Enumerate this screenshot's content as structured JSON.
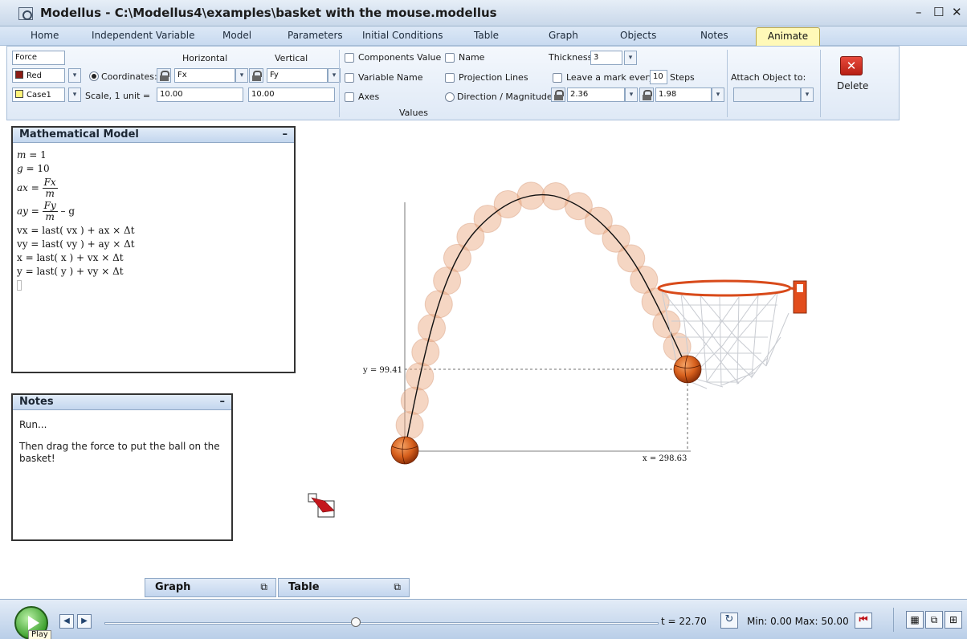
{
  "window": {
    "title": "Modellus - C:\\Modellus4\\examples\\basket with the mouse.modellus",
    "min": "–",
    "max": "☐",
    "close": "✕"
  },
  "tabs": [
    "Home",
    "Independent Variable",
    "Model",
    "Parameters",
    "Initial Conditions",
    "Table",
    "Graph",
    "Objects",
    "Notes",
    "Animate"
  ],
  "ribbon": {
    "name_value": "Force",
    "color_value": "Red",
    "color_swatch": "#8b1b13",
    "case_value": "Case1",
    "case_swatch": "#fff27a",
    "coordinates_label": "Coordinates:",
    "scale_label": "Scale, 1 unit =",
    "horizontal_label": "Horizontal",
    "vertical_label": "Vertical",
    "horizontal_var": "Fx",
    "vertical_var": "Fy",
    "horizontal_scale": "10.00",
    "vertical_scale": "10.00",
    "components_value": "Components Value",
    "variable_name": "Variable Name",
    "axes": "Axes",
    "name": "Name",
    "projection_lines": "Projection Lines",
    "direction_magnitude": "Direction / Magnitude:",
    "thickness_label": "Thickness:",
    "thickness_value": "3",
    "leave_mark": "Leave a mark every",
    "steps_value": "10",
    "steps_label": "Steps",
    "direction_value": "2.36",
    "magnitude_value": "1.98",
    "attach_label": "Attach Object to:",
    "values_label": "Values",
    "delete_label": "Delete",
    "delete_icon_glyph": "✕"
  },
  "model_panel": {
    "title": "Mathematical Model",
    "minimize": "–",
    "m_var": "m",
    "m_val": " = 1",
    "g_var": "g",
    "g_val": " = 10",
    "ax_lhs": "ax",
    "ax_num": "Fx",
    "ax_den": "m",
    "ay_lhs": "ay",
    "ay_num": "Fy",
    "ay_den": "m",
    "ay_tail": " – g",
    "vx": "vx = last( vx ) + ax × Δt",
    "vy": "vy = last( vy ) + ay × Δt",
    "x": "x = last( x ) + vx × Δt",
    "y": "y = last( y ) + vy × Δt"
  },
  "notes_panel": {
    "title": "Notes",
    "minimize": "–",
    "line1": "Run...",
    "line2": "Then drag the force to put the ball on the basket!"
  },
  "docked": {
    "graph": "Graph",
    "table": "Table",
    "restore_icon": "⧉"
  },
  "animation": {
    "y_label": "y = 99.41",
    "x_label": "x = 298.63",
    "ball_color": "#d9641e",
    "trail_color": "#e8a37b",
    "rim_color": "#e0461b"
  },
  "controls": {
    "play_label": "Play",
    "step_back": "◀",
    "step_fwd": "▶",
    "t_readout": "t  = 22.70",
    "progress": 0.454,
    "reset_glyph": "↻",
    "minmax": "Min: 0.00 Max: 50.00",
    "end_glyph": "⏮"
  }
}
